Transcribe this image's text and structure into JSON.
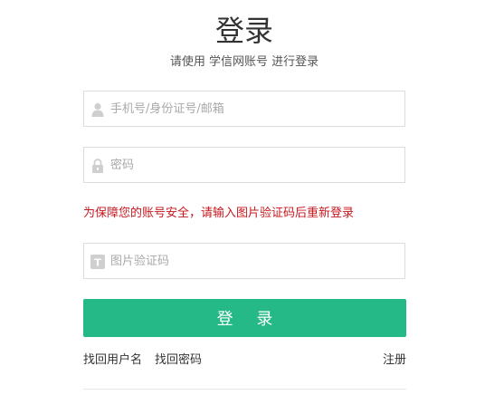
{
  "header": {
    "title": "登录",
    "subtitle": "请使用 学信网账号 进行登录"
  },
  "form": {
    "username": {
      "placeholder": "手机号/身份证号/邮箱",
      "value": "",
      "icon": "user-icon"
    },
    "password": {
      "placeholder": "密码",
      "value": "",
      "icon": "lock-icon"
    },
    "warning": "为保障您的账号安全，请输入图片验证码后重新登录",
    "captcha": {
      "placeholder": "图片验证码",
      "value": "",
      "icon": "captcha-t-icon",
      "icon_glyph": "T"
    },
    "submit_label": "登 录"
  },
  "links": {
    "find_username": "找回用户名",
    "find_password": "找回密码",
    "register": "注册"
  },
  "colors": {
    "accent": "#24b986",
    "warning": "#c6181f",
    "border": "#dcdcdc",
    "icon": "#cfcfcf"
  }
}
